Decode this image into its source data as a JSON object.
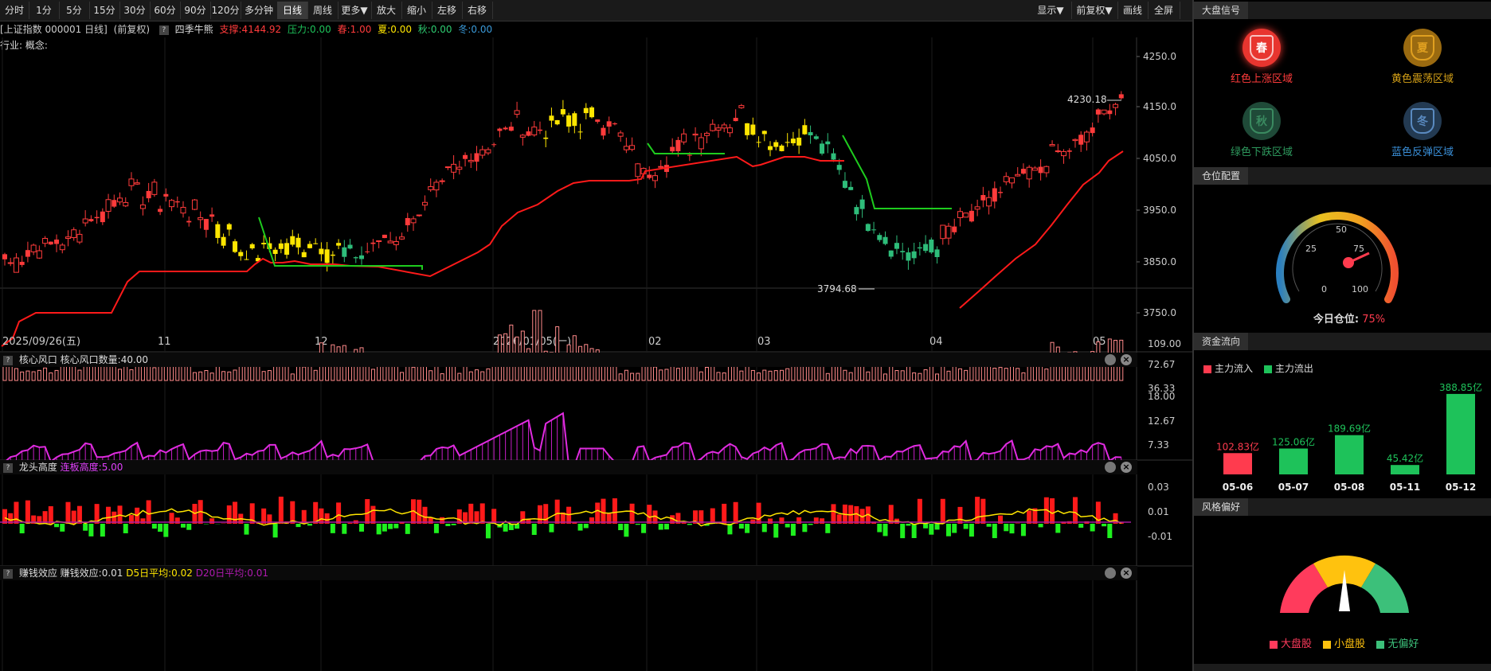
{
  "toolbar": {
    "buttons": [
      "分时",
      "1分",
      "5分",
      "15分",
      "30分",
      "60分",
      "90分",
      "120分",
      "多分钟",
      "日线",
      "周线",
      "更多▼",
      "放大",
      "缩小",
      "左移",
      "右移"
    ],
    "right_buttons": [
      "显示▼",
      "前复权▼",
      "画线",
      "全屏"
    ],
    "active": "日线"
  },
  "info": {
    "stock": "[上证指数 000001 日线]",
    "adjust": "(前复权)",
    "indicator": "四季牛熊",
    "support": "支撑:4144.92",
    "pressure": "压力:0.00",
    "spring": "春:1.00",
    "summer": "夏:0.00",
    "autumn": "秋:0.00",
    "winter": "冬:0.00",
    "industry": "行业: 概念:"
  },
  "price_axis": [
    "4250.0",
    "4150.0",
    "4050.0",
    "3950.0",
    "3850.0",
    "3750.0"
  ],
  "price_high_label": "4230.18",
  "price_low_label": "3794.68",
  "date_axis": [
    "2025/09/26(五)",
    "11",
    "12",
    "2026/01/05(一)",
    "02",
    "03",
    "04",
    "05"
  ],
  "panel1": {
    "title": "核心风口",
    "value": "核心风口数量:40.00",
    "ticks": [
      "109.00",
      "72.67",
      "36.33"
    ]
  },
  "panel2": {
    "title": "龙头高度",
    "value": "连板高度:5.00",
    "ticks": [
      "18.00",
      "12.67",
      "7.33"
    ]
  },
  "panel3": {
    "title": "赚钱效应",
    "value": "赚钱效应:0.01",
    "d5": "D5日平均:0.02",
    "d20": "D20日平均:0.01",
    "ticks": [
      "0.03",
      "0.01",
      "-0.01"
    ]
  },
  "right": {
    "signal_title": "大盘信号",
    "seasons": [
      {
        "char": "春",
        "label": "红色上涨区域",
        "color": "#ff3b3b",
        "bg": "#e8352f"
      },
      {
        "char": "夏",
        "label": "黄色震荡区域",
        "color": "#d4a017",
        "bg": "#9a6a10"
      },
      {
        "char": "秋",
        "label": "绿色下跌区域",
        "color": "#2e9a5e",
        "bg": "#1f4a38"
      },
      {
        "char": "冬",
        "label": "蓝色反弹区域",
        "color": "#3a8fd8",
        "bg": "#233a52"
      }
    ],
    "position_title": "仓位配置",
    "gauge_labels": [
      "0",
      "25",
      "50",
      "75",
      "100"
    ],
    "position_text": "今日仓位:",
    "position_value": "75%",
    "flow_title": "资金流向",
    "flow_in": "主力流入",
    "flow_out": "主力流出",
    "style_title": "风格偏好",
    "style_legend": [
      "大盘股",
      "小盘股",
      "无偏好"
    ]
  },
  "chart_data": {
    "type": "bar",
    "title": "资金流向",
    "categories": [
      "05-06",
      "05-07",
      "05-08",
      "05-11",
      "05-12"
    ],
    "values": [
      102.83,
      125.06,
      189.69,
      45.42,
      388.85
    ],
    "value_labels": [
      "102.83亿",
      "125.06亿",
      "189.69亿",
      "45.42亿",
      "388.85亿"
    ],
    "series_colors": [
      "#ff3b4e",
      "#1ec25a",
      "#1ec25a",
      "#1ec25a",
      "#1ec25a"
    ]
  }
}
